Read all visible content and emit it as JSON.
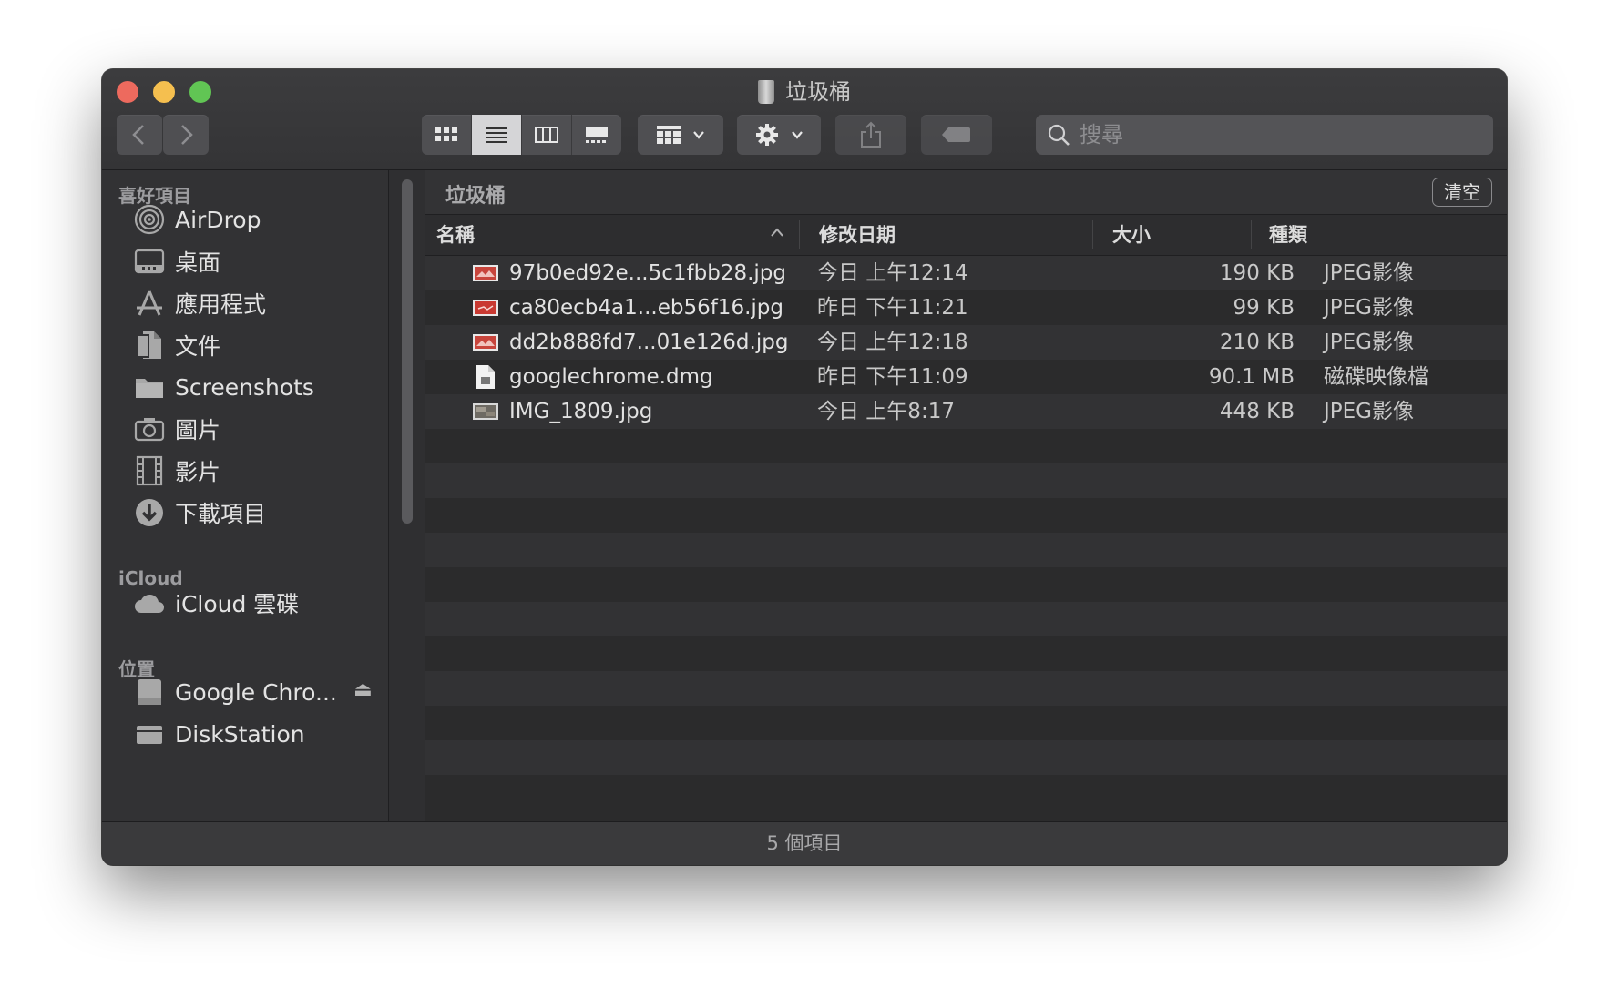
{
  "window": {
    "title": "垃圾桶"
  },
  "toolbar": {
    "search_placeholder": "搜尋"
  },
  "sidebar": {
    "sections": [
      {
        "title": "喜好項目",
        "items": [
          {
            "label": "AirDrop",
            "icon": "airdrop-icon"
          },
          {
            "label": "桌面",
            "icon": "desktop-icon"
          },
          {
            "label": "應用程式",
            "icon": "applications-icon"
          },
          {
            "label": "文件",
            "icon": "documents-icon"
          },
          {
            "label": "Screenshots",
            "icon": "folder-icon"
          },
          {
            "label": "圖片",
            "icon": "camera-icon"
          },
          {
            "label": "影片",
            "icon": "film-icon"
          },
          {
            "label": "下載項目",
            "icon": "download-icon"
          }
        ]
      },
      {
        "title": "iCloud",
        "items": [
          {
            "label": "iCloud 雲碟",
            "icon": "cloud-icon"
          }
        ]
      },
      {
        "title": "位置",
        "items": [
          {
            "label": "Google Chro...",
            "icon": "disk-icon"
          },
          {
            "label": "DiskStation",
            "icon": "server-icon"
          }
        ]
      }
    ]
  },
  "content": {
    "path_title": "垃圾桶",
    "empty_button": "清空",
    "columns": [
      "名稱",
      "修改日期",
      "大小",
      "種類"
    ],
    "files": [
      {
        "name": "97b0ed92e...5c1fbb28.jpg",
        "date": "今日 上午12:14",
        "size": "190 KB",
        "kind": "JPEG影像",
        "icon": "jpeg-icon"
      },
      {
        "name": "ca80ecb4a1...eb56f16.jpg",
        "date": "昨日 下午11:21",
        "size": "99 KB",
        "kind": "JPEG影像",
        "icon": "jpeg-icon"
      },
      {
        "name": "dd2b888fd7...01e126d.jpg",
        "date": "今日 上午12:18",
        "size": "210 KB",
        "kind": "JPEG影像",
        "icon": "jpeg-icon"
      },
      {
        "name": "googlechrome.dmg",
        "date": "昨日 下午11:09",
        "size": "90.1 MB",
        "kind": "磁碟映像檔",
        "icon": "dmg-file-icon"
      },
      {
        "name": "IMG_1809.jpg",
        "date": "今日 上午8:17",
        "size": "448 KB",
        "kind": "JPEG影像",
        "icon": "photo-thumbnail-icon"
      }
    ]
  },
  "status": {
    "item_count": "5 個項目"
  }
}
